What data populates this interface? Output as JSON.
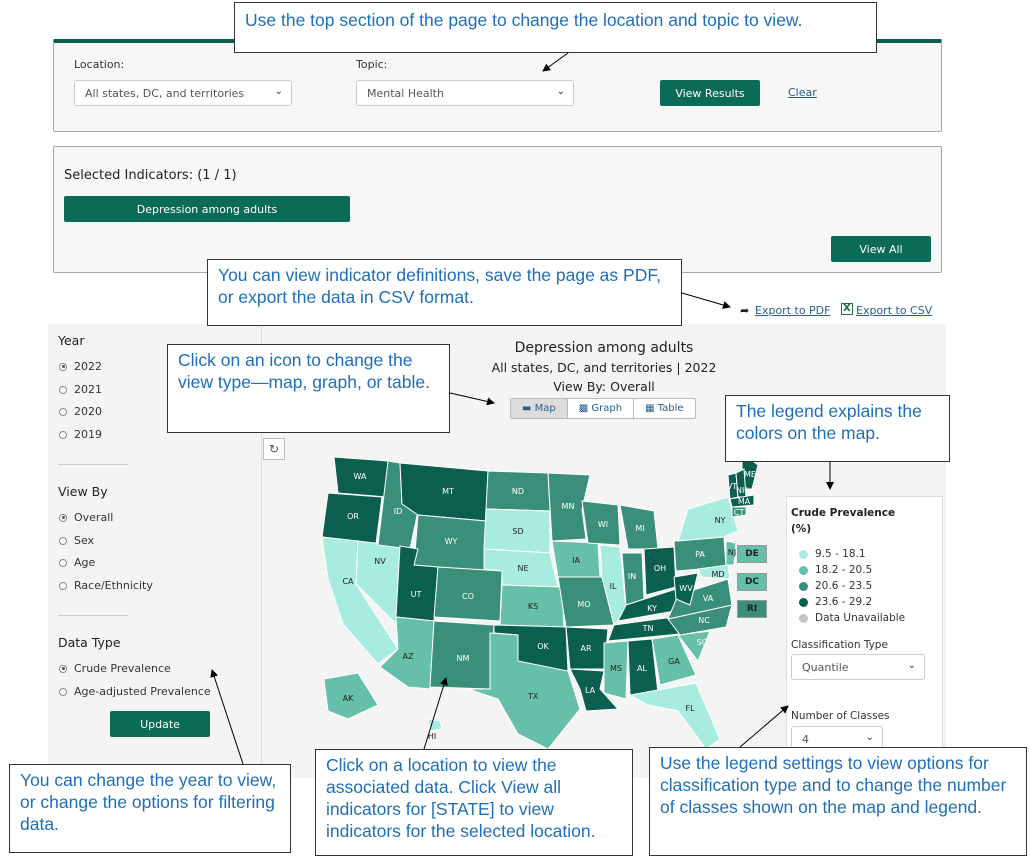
{
  "filters": {
    "location_label": "Location:",
    "location_value": "All states, DC, and territories",
    "topic_label": "Topic:",
    "topic_value": "Mental Health",
    "view_results_label": "View Results",
    "clear_label": "Clear"
  },
  "indicators": {
    "heading": "Selected Indicators: (1 / 1)",
    "selected": "Depression among adults",
    "view_all_label": "View All"
  },
  "export": {
    "pdf_label": "Export to PDF",
    "csv_label": "Export to CSV"
  },
  "sidebar": {
    "year_title": "Year",
    "years": [
      "2022",
      "2021",
      "2020",
      "2019"
    ],
    "selected_year": "2022",
    "view_by_title": "View By",
    "view_by_options": [
      "Overall",
      "Sex",
      "Age",
      "Race/Ethnicity"
    ],
    "selected_view_by": "Overall",
    "data_type_title": "Data Type",
    "data_type_options": [
      "Crude Prevalence",
      "Age-adjusted Prevalence"
    ],
    "selected_data_type": "Crude Prevalence",
    "update_label": "Update"
  },
  "map": {
    "title": "Depression among adults",
    "subtitle": "All states, DC, and territories | 2022",
    "view_by_text": "View By: Overall",
    "view_tabs": [
      "Map",
      "Graph",
      "Table"
    ],
    "active_view": "Map",
    "small_states": [
      "DE",
      "DC",
      "RI"
    ],
    "state_labels": [
      "WA",
      "OR",
      "CA",
      "NV",
      "ID",
      "MT",
      "WY",
      "UT",
      "AZ",
      "CO",
      "NM",
      "ND",
      "SD",
      "NE",
      "KS",
      "OK",
      "TX",
      "MN",
      "IA",
      "MO",
      "AR",
      "LA",
      "WI",
      "IL",
      "MI",
      "IN",
      "OH",
      "KY",
      "TN",
      "MS",
      "AL",
      "GA",
      "FL",
      "SC",
      "NC",
      "VA",
      "WV",
      "PA",
      "NY",
      "MD",
      "NJ",
      "ME",
      "VT",
      "NH",
      "MA",
      "CT",
      "AK",
      "HI"
    ]
  },
  "legend": {
    "title": "Crude Prevalence (%)",
    "items": [
      {
        "label": "9.5 - 18.1",
        "color": "#a8ece0"
      },
      {
        "label": "18.2 - 20.5",
        "color": "#66bfa8"
      },
      {
        "label": "20.6 - 23.5",
        "color": "#3a8f7a"
      },
      {
        "label": "23.6 - 29.2",
        "color": "#0b5f4f"
      },
      {
        "label": "Data Unavailable",
        "color": "#c4c4c4"
      }
    ],
    "classification_label": "Classification Type",
    "classification_value": "Quantile",
    "classes_label": "Number of Classes",
    "classes_value": "4"
  },
  "callouts": {
    "top": "Use the top section of the page to change the location and topic to view.",
    "export": "You can view indicator definitions, save the page as PDF, or export the data in CSV format.",
    "icon": "Click on an icon to change the view type—map, graph, or table.",
    "legend": "The legend explains the colors on the map.",
    "year": "You can change the year to view, or change the options for filtering data.",
    "location": "Click on a location to view the associated data. Click View all indicators for [STATE] to view indicators for the selected location.",
    "settings": "Use the legend settings to view options for classification type and to change the number of classes shown on the map and legend."
  }
}
